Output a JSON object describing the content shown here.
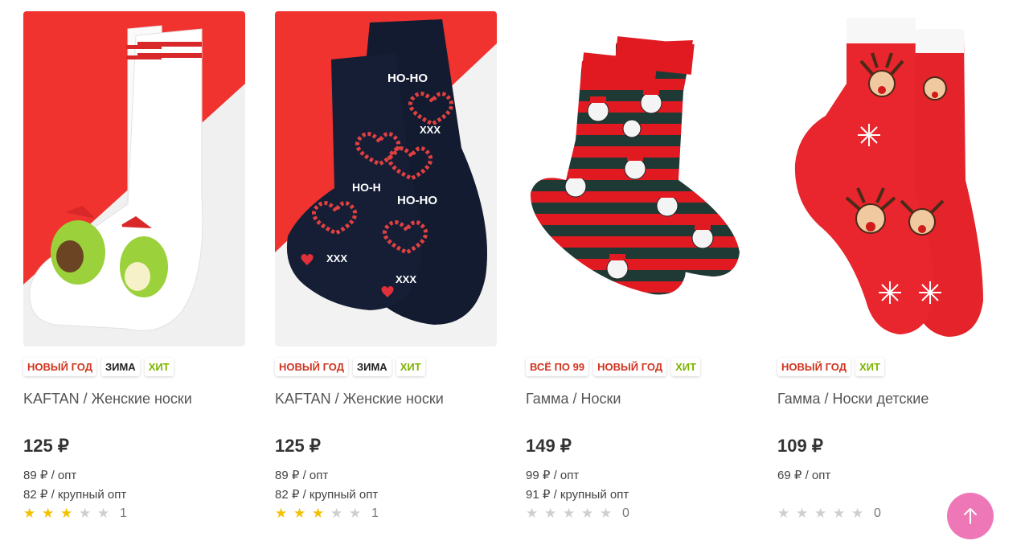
{
  "colors": {
    "badge_red": "#d0341f",
    "badge_dark": "#222222",
    "badge_green": "#7db400",
    "star_on": "#f2c200",
    "star_off": "#cfcfcf",
    "scroll_button": "#ee77b8"
  },
  "products": [
    {
      "image": "avocado-christmas-socks",
      "badges": [
        {
          "label": "НОВЫЙ ГОД",
          "color": "#d0341f"
        },
        {
          "label": "ЗИМА",
          "color": "#222222"
        },
        {
          "label": "ХИТ",
          "color": "#7db400"
        }
      ],
      "title": "KAFTAN / Женские носки",
      "price": "125 ₽",
      "opt_lines": [
        "89 ₽ / опт",
        "82 ₽ / крупный опт"
      ],
      "rating": 3,
      "reviews": "1"
    },
    {
      "image": "navy-hoho-candy-cane-socks",
      "badges": [
        {
          "label": "НОВЫЙ ГОД",
          "color": "#d0341f"
        },
        {
          "label": "ЗИМА",
          "color": "#222222"
        },
        {
          "label": "ХИТ",
          "color": "#7db400"
        }
      ],
      "title": "KAFTAN / Женские носки",
      "price": "125 ₽",
      "opt_lines": [
        "89 ₽ / опт",
        "82 ₽ / крупный опт"
      ],
      "rating": 3,
      "reviews": "1"
    },
    {
      "image": "striped-santa-socks",
      "badges": [
        {
          "label": "ВСЁ ПО 99",
          "color": "#d0341f"
        },
        {
          "label": "НОВЫЙ ГОД",
          "color": "#d0341f"
        },
        {
          "label": "ХИТ",
          "color": "#7db400"
        }
      ],
      "title": "Гамма / Носки",
      "price": "149 ₽",
      "opt_lines": [
        "99 ₽ / опт",
        "91 ₽ / крупный опт"
      ],
      "rating": 0,
      "reviews": "0"
    },
    {
      "image": "red-reindeer-kids-socks",
      "badges": [
        {
          "label": "НОВЫЙ ГОД",
          "color": "#d0341f"
        },
        {
          "label": "ХИТ",
          "color": "#7db400"
        }
      ],
      "title": "Гамма / Носки детские",
      "price": "109 ₽",
      "opt_lines": [
        "69 ₽ / опт"
      ],
      "rating": 0,
      "reviews": "0"
    }
  ],
  "scroll_top": {
    "icon": "arrow-up-icon"
  }
}
